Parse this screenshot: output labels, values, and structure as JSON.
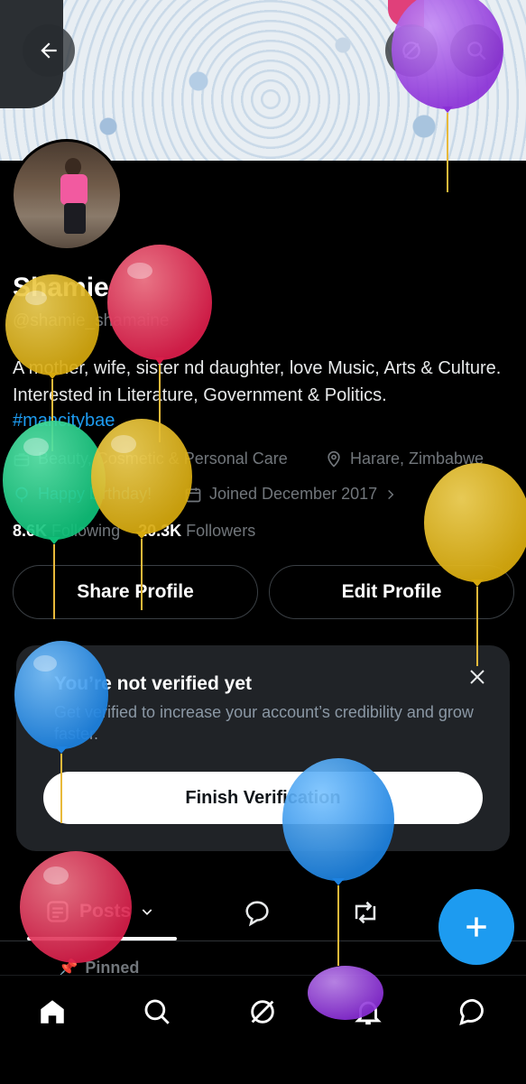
{
  "profile": {
    "name": "Shamie",
    "handle": "@shamie_shamaine",
    "bio": "A mother, wife, sister nd daughter, love Music, Arts & Culture. Interested in Literature, Government & Politics.",
    "hashtag": "#mancitybae",
    "category": "Beauty, Cosmetic & Personal Care",
    "location": "Harare, Zimbabwe",
    "birthday": "Happy birthday!",
    "joined": "Joined December 2017",
    "following_count": "8.6K",
    "following_label": "Following",
    "followers_count": "20.3K",
    "followers_label": "Followers"
  },
  "actions": {
    "share": "Share Profile",
    "edit": "Edit Profile"
  },
  "verify": {
    "title": "You’re not verified yet",
    "description": "Get verified to increase your account’s credibility and grow faster.",
    "button": "Finish Verification"
  },
  "tabs": {
    "posts": "Posts"
  },
  "pinned": "Pinned",
  "colors": {
    "accent": "#1d9bf0",
    "background": "#000000",
    "card": "#202327",
    "muted": "#71767b"
  },
  "icons": {
    "back": "arrow-left-icon",
    "grok": "grok-icon",
    "search": "search-icon",
    "fab": "plus-icon",
    "nav": [
      "home-icon",
      "search-icon",
      "grok-icon",
      "bell-icon",
      "message-icon"
    ]
  },
  "overlay": {
    "balloons": [
      "purple",
      "red",
      "yellow",
      "green",
      "yellow",
      "yellow",
      "blue",
      "blue",
      "red",
      "purple"
    ]
  }
}
